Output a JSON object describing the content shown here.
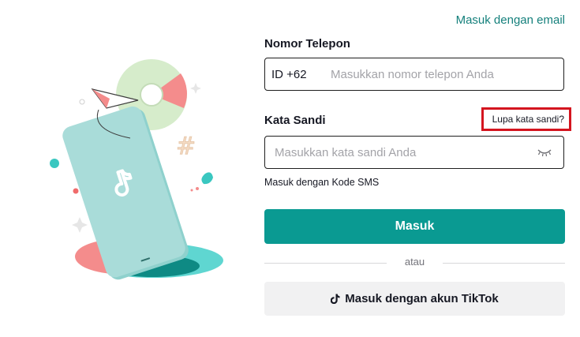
{
  "header": {
    "email_login_link": "Masuk dengan email"
  },
  "phone": {
    "label": "Nomor Telepon",
    "country_code": "ID +62",
    "placeholder": "Masukkan nomor telepon Anda"
  },
  "password": {
    "label": "Kata Sandi",
    "placeholder": "Masukkan kata sandi Anda",
    "forgot_link": "Lupa kata sandi?",
    "visibility_icon": "eye-closed-icon"
  },
  "sms_login_link": "Masuk dengan Kode SMS",
  "login_button": "Masuk",
  "divider_text": "atau",
  "tiktok_button": {
    "label": "Masuk dengan akun TikTok",
    "icon": "tiktok-logo-icon"
  },
  "colors": {
    "accent": "#0a9a92",
    "link": "#15807c",
    "highlight_border": "#d4151f",
    "placeholder": "#a3a3a8"
  }
}
